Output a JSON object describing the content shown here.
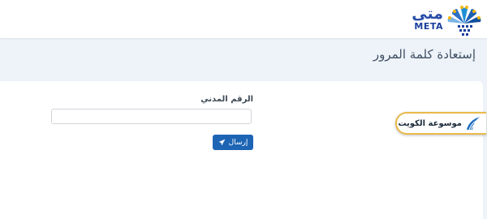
{
  "header": {
    "logo_ar": "متى",
    "logo_en": "META"
  },
  "page": {
    "title": "إستعادة كلمة المرور"
  },
  "form": {
    "civil_id_label": "الرقم المدني",
    "civil_id_value": "",
    "civil_id_placeholder": "",
    "send_label": "إرسال"
  },
  "widget": {
    "encyclopedia_label": "موسوعة الكويت"
  },
  "colors": {
    "primary": "#1d64b5",
    "band": "#eef3f9",
    "widget_border": "#e9b94a"
  }
}
